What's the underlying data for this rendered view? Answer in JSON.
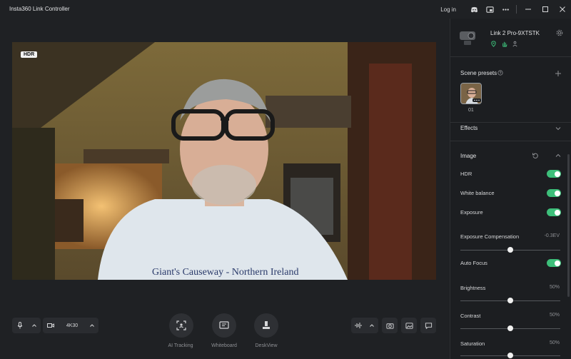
{
  "app": {
    "title": "Insta360 Link Controller",
    "login": "Log in"
  },
  "titlebar_icons": [
    "discord-icon",
    "picture-in-picture-icon",
    "more-icon"
  ],
  "window_controls": [
    "minimize-icon",
    "maximize-icon",
    "close-icon"
  ],
  "preview": {
    "badge": "HDR",
    "shirt_text": "Giant's Causeway - Northern Ireland"
  },
  "bottom_controls": {
    "resolution": "4K30",
    "modes": [
      {
        "label": "AI Tracking",
        "icon": "ai-tracking-icon"
      },
      {
        "label": "Whiteboard",
        "icon": "whiteboard-icon"
      },
      {
        "label": "DeskView",
        "icon": "deskview-icon"
      }
    ]
  },
  "device": {
    "name": "Link 2 Pro-9XTSTK"
  },
  "sections": {
    "scene_presets": {
      "title": "Scene presets",
      "preset_label": "01"
    },
    "effects": {
      "title": "Effects"
    },
    "image": {
      "title": "Image",
      "toggles": [
        {
          "label": "HDR",
          "on": true
        },
        {
          "label": "White balance",
          "on": true
        },
        {
          "label": "Exposure",
          "on": true
        }
      ],
      "exposure_compensation": {
        "label": "Exposure Compensation",
        "value": "-0.3EV",
        "level": 0.5
      },
      "auto_focus": {
        "label": "Auto Focus",
        "on": true
      },
      "sliders": [
        {
          "label": "Brightness",
          "value": "50%",
          "level": 0.5
        },
        {
          "label": "Contrast",
          "value": "50%",
          "level": 0.5
        },
        {
          "label": "Saturation",
          "value": "50%",
          "level": 0.5
        }
      ]
    }
  },
  "colors": {
    "accent": "#3dbf7a",
    "background": "#1f2124",
    "sidebar": "#1c1e21"
  }
}
